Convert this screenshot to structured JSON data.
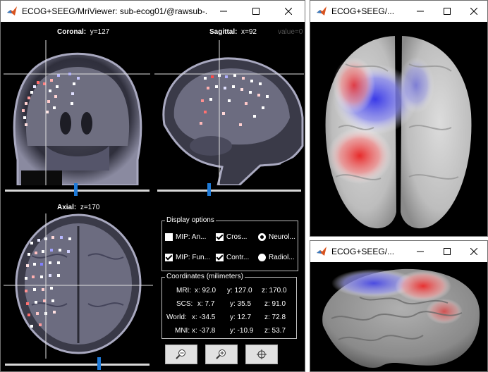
{
  "main_window": {
    "title": "ECOG+SEEG/MriViewer: sub-ecog01/@rawsub-...",
    "views": {
      "coronal": {
        "name": "Coronal",
        "coord": "y=127",
        "slider_fraction": 0.49
      },
      "sagittal": {
        "name": "Sagittal",
        "coord": "x=92",
        "value": "value=0",
        "slider_fraction": 0.36
      },
      "axial": {
        "name": "Axial",
        "coord": "z=170",
        "slider_fraction": 0.65
      }
    },
    "display_options": {
      "title": "Display options",
      "items": [
        {
          "label": "MIP: An...",
          "type": "checkbox",
          "checked": false
        },
        {
          "label": "Cros...",
          "type": "checkbox",
          "checked": true
        },
        {
          "label": "Neurol...",
          "type": "radio",
          "checked": true
        },
        {
          "label": "MIP: Fun...",
          "type": "checkbox",
          "checked": true
        },
        {
          "label": "Contr...",
          "type": "checkbox",
          "checked": true
        },
        {
          "label": "Radiol...",
          "type": "radio",
          "checked": false
        }
      ]
    },
    "coordinates": {
      "title": "Coordinates (milimeters)",
      "rows": [
        {
          "label": "MRI:",
          "x": "x: 92.0",
          "y": "y: 127.0",
          "z": "z: 170.0"
        },
        {
          "label": "SCS:",
          "x": "x: 7.7",
          "y": "y: 35.5",
          "z": "z: 91.0"
        },
        {
          "label": "World:",
          "x": "x: -34.5",
          "y": "y: 12.7",
          "z": "z: 72.8"
        },
        {
          "label": "MNI:",
          "x": "x: -37.8",
          "y": "y: -10.9",
          "z": "z: 53.7"
        }
      ]
    },
    "toolbar": {
      "zoom_out_icon": "zoom-out-icon",
      "zoom_in_icon": "zoom-in-icon",
      "center_icon": "crosshair-icon"
    }
  },
  "surface_window_top": {
    "title": "ECOG+SEEG/..."
  },
  "surface_window_bottom": {
    "title": "ECOG+SEEG/..."
  },
  "colors": {
    "accent": "#1e7ad8",
    "background": "#000000",
    "titlebar": "#ffffff"
  }
}
